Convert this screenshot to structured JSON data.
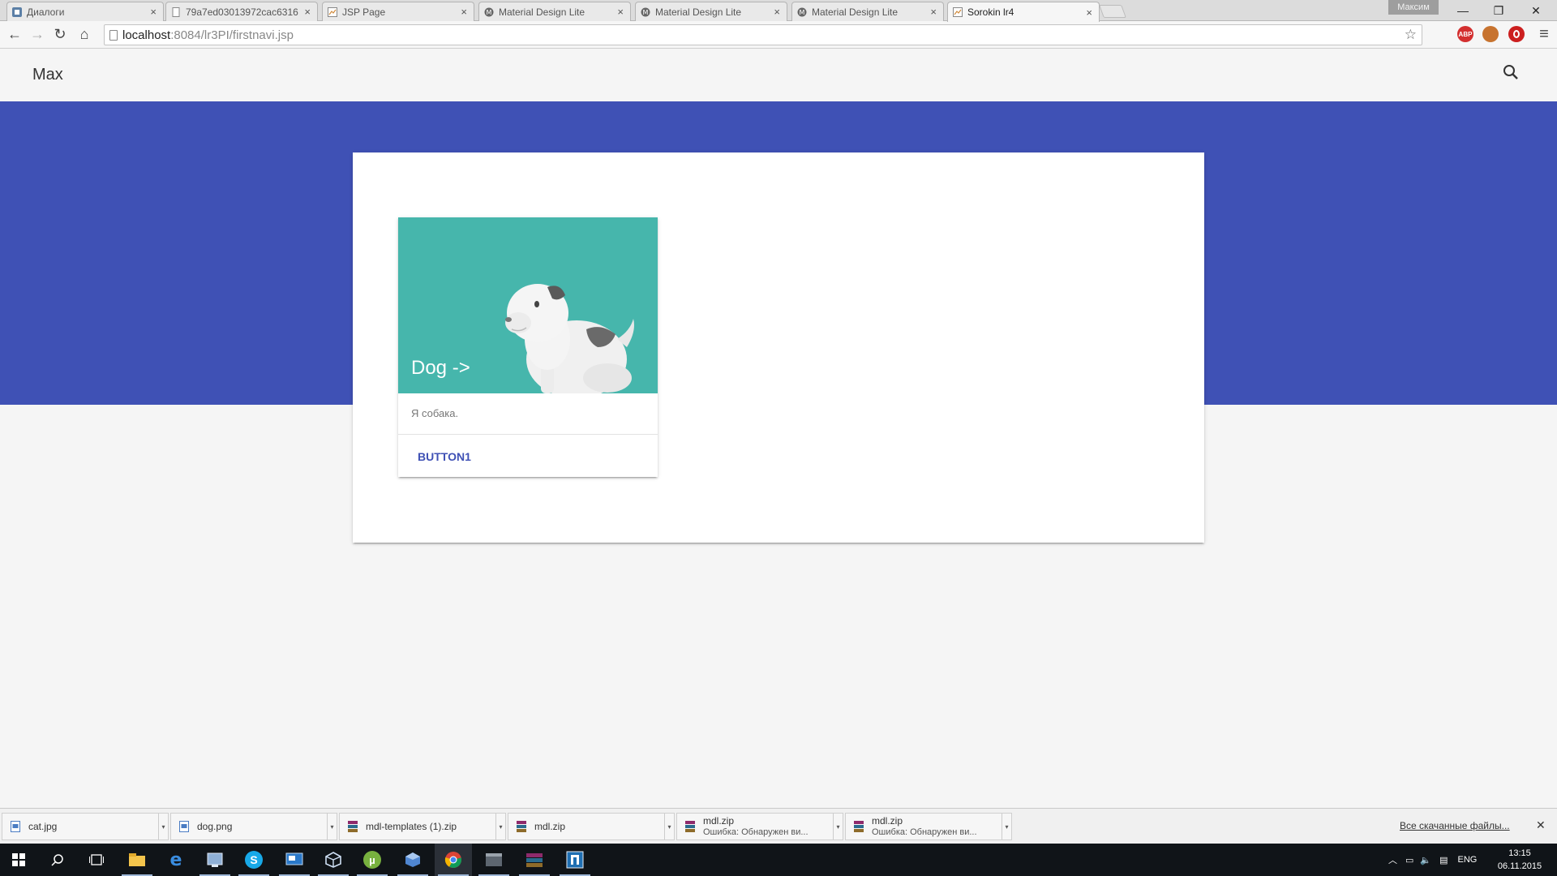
{
  "browser": {
    "tabs": [
      {
        "label": "Диалоги",
        "active": false
      },
      {
        "label": "79a7ed03013972cac6316",
        "active": false
      },
      {
        "label": "JSP Page",
        "active": false
      },
      {
        "label": "Material Design Lite",
        "active": false
      },
      {
        "label": "Material Design Lite",
        "active": false
      },
      {
        "label": "Material Design Lite",
        "active": false
      },
      {
        "label": "Sorokin lr4",
        "active": true
      }
    ],
    "user_name": "Максим",
    "url_host": "localhost",
    "url_rest": ":8084/lr3PI/firstnavi.jsp",
    "extensions": [
      {
        "name": "adblock-plus-icon",
        "text": "ABP",
        "color": "#d32f2f"
      },
      {
        "name": "extension-icon",
        "text": "",
        "color": "#c7732f"
      },
      {
        "name": "opera-icon",
        "text": "",
        "color": "#cc1f1f"
      }
    ]
  },
  "page": {
    "header_title": "Max",
    "hero_color": "#3f51b5",
    "card": {
      "title": "Dog ->",
      "supporting_text": "Я собака.",
      "button_label": "BUTTON1",
      "media_color": "#46b6ac"
    }
  },
  "downloads": {
    "items": [
      {
        "name": "cat.jpg",
        "status": "",
        "type": "image"
      },
      {
        "name": "dog.png",
        "status": "",
        "type": "image"
      },
      {
        "name": "mdl-templates (1).zip",
        "status": "",
        "type": "archive"
      },
      {
        "name": "mdl.zip",
        "status": "",
        "type": "archive"
      },
      {
        "name": "mdl.zip",
        "status": "Ошибка: Обнаружен ви...",
        "type": "archive"
      },
      {
        "name": "mdl.zip",
        "status": "Ошибка: Обнаружен ви...",
        "type": "archive"
      }
    ],
    "show_all_label": "Все скачанные файлы..."
  },
  "taskbar": {
    "language": "ENG",
    "time": "13:15",
    "date": "06.11.2015"
  }
}
